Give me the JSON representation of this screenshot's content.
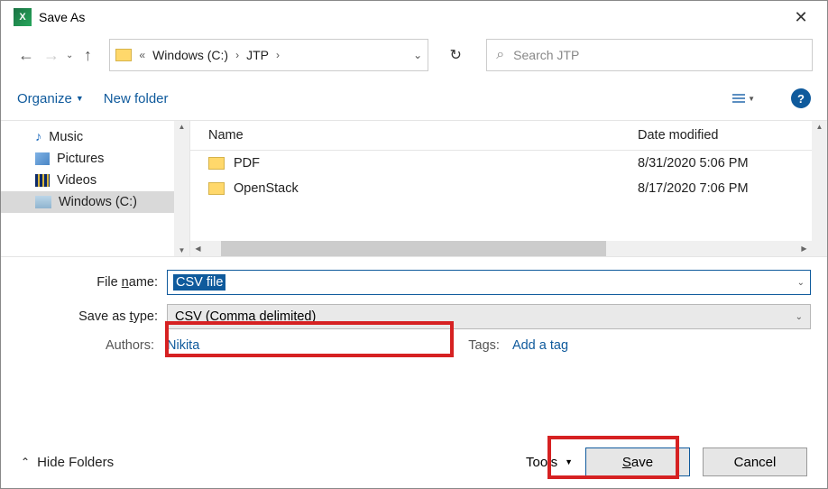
{
  "window": {
    "title": "Save As"
  },
  "breadcrumbs": {
    "drive": "Windows (C:)",
    "folder": "JTP"
  },
  "search": {
    "placeholder": "Search JTP"
  },
  "toolbar": {
    "organize": "Organize",
    "newfolder": "New folder"
  },
  "tree": {
    "items": [
      {
        "label": "Music"
      },
      {
        "label": "Pictures"
      },
      {
        "label": "Videos"
      },
      {
        "label": "Windows (C:)"
      }
    ]
  },
  "columns": {
    "name": "Name",
    "date": "Date modified"
  },
  "rows": [
    {
      "name": "PDF",
      "date": "8/31/2020 5:06 PM"
    },
    {
      "name": "OpenStack",
      "date": "8/17/2020 7:06 PM"
    }
  ],
  "form": {
    "filename_label": "File name:",
    "filename_value": "CSV file",
    "savetype_label": "Save as type:",
    "savetype_value": "CSV (Comma delimited)",
    "authors_label": "Authors:",
    "authors_value": "Nikita",
    "tags_label": "Tags:",
    "tags_value": "Add a tag"
  },
  "bottom": {
    "hide": "Hide Folders",
    "tools": "Tools",
    "save": "Save",
    "cancel": "Cancel"
  }
}
